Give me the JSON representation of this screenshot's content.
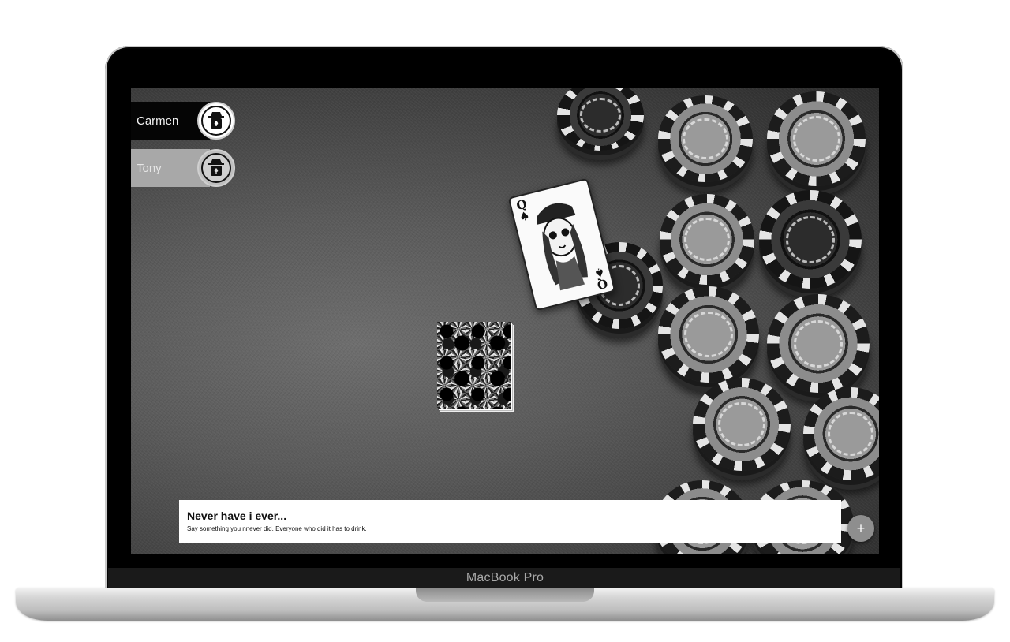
{
  "device": {
    "label": "MacBook Pro"
  },
  "players": [
    {
      "name": "Carmen",
      "state": "active"
    },
    {
      "name": "Tony",
      "state": "inactive"
    }
  ],
  "table": {
    "face_card": {
      "rank": "Q",
      "suit": "♠"
    }
  },
  "prompt": {
    "title": "Never have i ever...",
    "description": "Say something you nnever did. Everyone who did it has to drink."
  },
  "fab": {
    "icon": "+"
  },
  "colors": {
    "active_bar": "#050505",
    "inactive_bar": "#a8a8a8",
    "prompt_bg": "#ffffff",
    "fab_bg": "#8e8e8e"
  }
}
